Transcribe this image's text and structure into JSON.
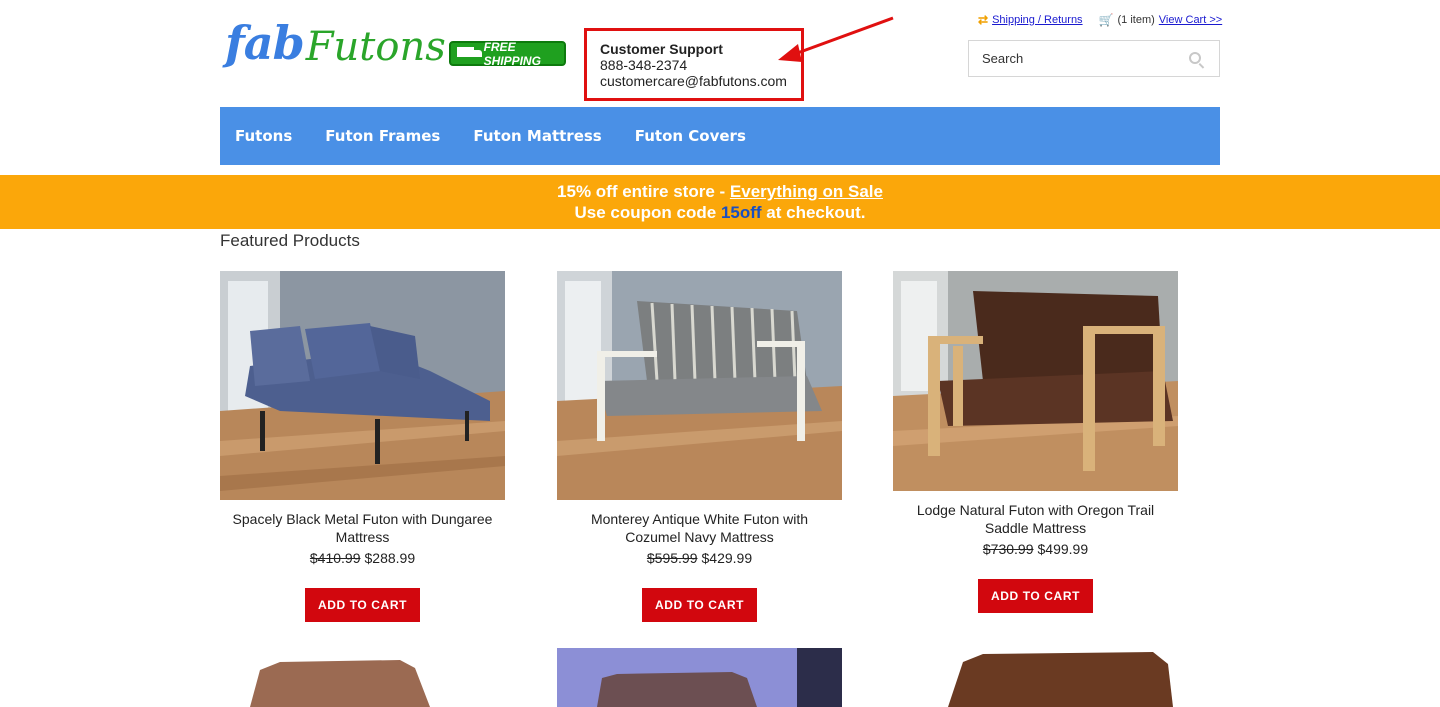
{
  "header": {
    "logo_part1": "fab",
    "logo_part2": "Futons",
    "free_shipping": "FREE SHIPPING",
    "support_title": "Customer Support",
    "support_phone": "888-348-2374",
    "support_email": "customercare@fabfutons.com",
    "shipping_link": "Shipping / Returns",
    "cart_count": "(1 item)",
    "view_cart": "View Cart >>",
    "search_placeholder": "Search"
  },
  "nav": {
    "items": [
      {
        "label": "Futons"
      },
      {
        "label": "Futon Frames"
      },
      {
        "label": "Futon Mattress"
      },
      {
        "label": "Futon Covers"
      }
    ]
  },
  "promo": {
    "line1_prefix": "15% off entire store - ",
    "line1_link": "Everything on Sale",
    "line2_prefix": "Use coupon code ",
    "line2_code": "15off",
    "line2_suffix": " at checkout."
  },
  "featured": {
    "title": "Featured Products",
    "products": [
      {
        "name": "Spacely Black Metal Futon with Dungaree Mattress",
        "old_price": "$410.99",
        "price": "$288.99",
        "button": "ADD TO CART"
      },
      {
        "name": "Monterey Antique White Futon with Cozumel Navy Mattress",
        "old_price": "$595.99",
        "price": "$429.99",
        "button": "ADD TO CART"
      },
      {
        "name": "Lodge Natural Futon with Oregon Trail Saddle Mattress",
        "old_price": "$730.99",
        "price": "$499.99",
        "button": "ADD TO CART"
      }
    ]
  },
  "colors": {
    "nav": "#4a90e6",
    "promo": "#fba70a",
    "button": "#d2070e",
    "highlight_box": "#e01010"
  }
}
